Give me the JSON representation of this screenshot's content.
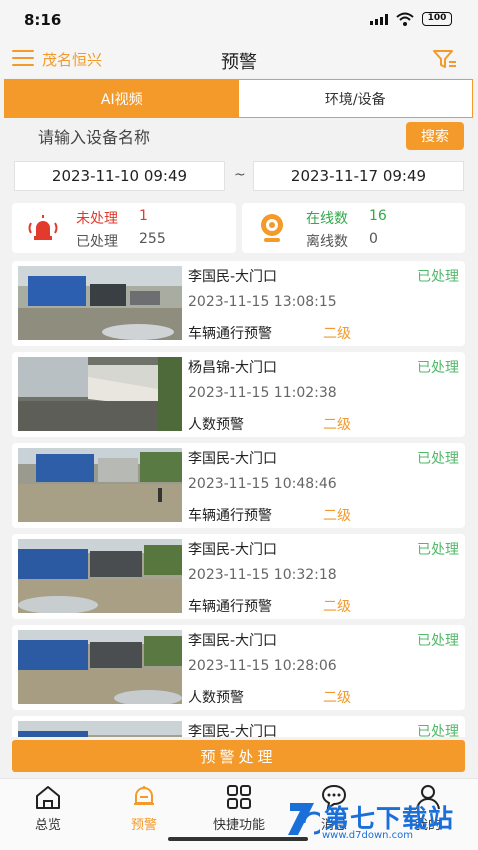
{
  "status_bar": {
    "time": "8:16",
    "battery": "100"
  },
  "header": {
    "org_name": "茂名恒兴",
    "title": "预警"
  },
  "tabs": [
    {
      "label": "AI视频",
      "active": true
    },
    {
      "label": "环境/设备",
      "active": false
    }
  ],
  "search": {
    "placeholder": "请输入设备名称",
    "button_label": "搜索"
  },
  "date_range": {
    "start": "2023-11-10 09:49",
    "separator": "~",
    "end": "2023-11-17 09:49"
  },
  "alarm_stats": {
    "unprocessed_label": "未处理",
    "unprocessed_count": "1",
    "processed_label": "已处理",
    "processed_count": "255"
  },
  "device_stats": {
    "online_label": "在线数",
    "online_count": "16",
    "offline_label": "离线数",
    "offline_count": "0"
  },
  "alerts": [
    {
      "title": "李国民-大门口",
      "status": "已处理",
      "time": "2023-11-15 13:08:15",
      "type": "车辆通行预警",
      "level": "二级"
    },
    {
      "title": "杨昌锦-大门口",
      "status": "已处理",
      "time": "2023-11-15 11:02:38",
      "type": "人数预警",
      "level": "二级"
    },
    {
      "title": "李国民-大门口",
      "status": "已处理",
      "time": "2023-11-15 10:48:46",
      "type": "车辆通行预警",
      "level": "二级"
    },
    {
      "title": "李国民-大门口",
      "status": "已处理",
      "time": "2023-11-15 10:32:18",
      "type": "车辆通行预警",
      "level": "二级"
    },
    {
      "title": "李国民-大门口",
      "status": "已处理",
      "time": "2023-11-15 10:28:06",
      "type": "人数预警",
      "level": "二级"
    },
    {
      "title": "李国民-大门口",
      "status": "已处理",
      "time": "",
      "type": "",
      "level": ""
    }
  ],
  "action_button": "预警处理",
  "bottom_nav": [
    {
      "label": "总览",
      "icon": "home-icon",
      "active": false
    },
    {
      "label": "预警",
      "icon": "bell-icon",
      "active": true
    },
    {
      "label": "快捷功能",
      "icon": "grid-icon",
      "active": false
    },
    {
      "label": "消息",
      "icon": "chat-icon",
      "active": false
    },
    {
      "label": "我的",
      "icon": "user-icon",
      "active": false
    }
  ],
  "watermark": {
    "text": "第七下载站",
    "url": "www.d7down.com"
  },
  "colors": {
    "accent": "#f39a2b",
    "processed": "#52b86a",
    "alarm_red": "#e23b2e",
    "online_green": "#2fa94a"
  }
}
